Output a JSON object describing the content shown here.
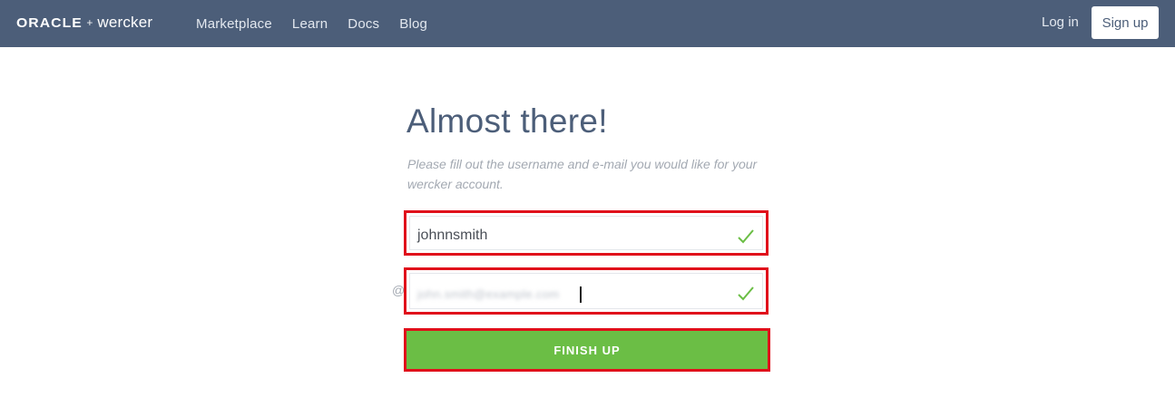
{
  "navbar": {
    "brand": {
      "oracle": "ORACLE",
      "plus": "+",
      "wercker": "wercker"
    },
    "links": [
      "Marketplace",
      "Learn",
      "Docs",
      "Blog"
    ],
    "login_label": "Log in",
    "signup_label": "Sign up"
  },
  "main": {
    "title": "Almost there!",
    "subtitle": "Please fill out the username and e-mail you would like for your wercker account.",
    "username": {
      "value": "johnnsmith",
      "valid": true
    },
    "email": {
      "value": "john.smith@example.com",
      "prefix_icon": "@",
      "valid": true
    },
    "finish_label": "FINISH UP"
  },
  "colors": {
    "navbar": "#4c5e79",
    "accent_green": "#6bbe45",
    "highlight_red": "#e0101b"
  }
}
